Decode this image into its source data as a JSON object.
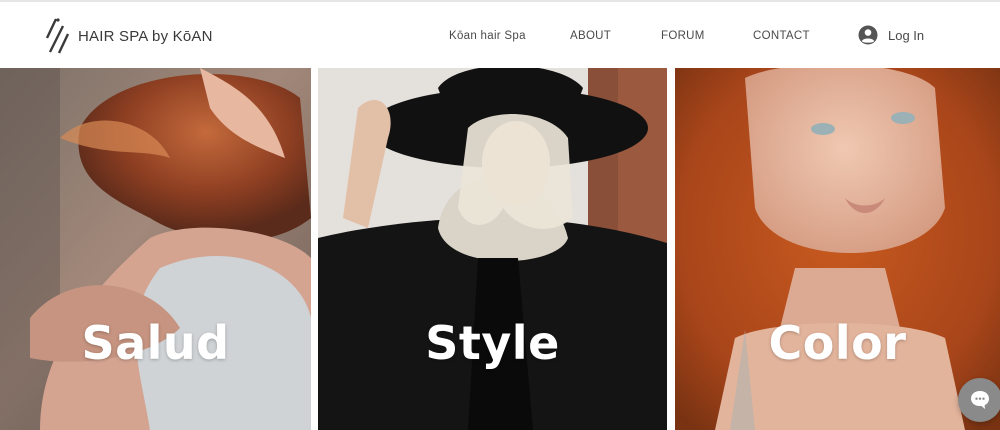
{
  "header": {
    "brand": "HAIR SPA by KōAN",
    "logo_icon": "slashes-logo-icon",
    "nav": [
      {
        "label": "Kōan hair Spa"
      },
      {
        "label": "ABOUT"
      },
      {
        "label": "FORUM"
      },
      {
        "label": "CONTACT"
      }
    ],
    "login": {
      "label": "Log In",
      "icon": "user-avatar-icon"
    }
  },
  "panels": [
    {
      "title": "Salud",
      "image": "woman with windswept auburn hair hugging her knees"
    },
    {
      "title": "Style",
      "image": "blonde woman in black hat and black coat"
    },
    {
      "title": "Color",
      "image": "freckled woman with curly red hair"
    }
  ],
  "chat": {
    "icon": "chat-bubble-icon"
  },
  "colors": {
    "accent_gray": "#8a8a8a",
    "text": "#4a4a4a",
    "title": "#ffffff"
  }
}
